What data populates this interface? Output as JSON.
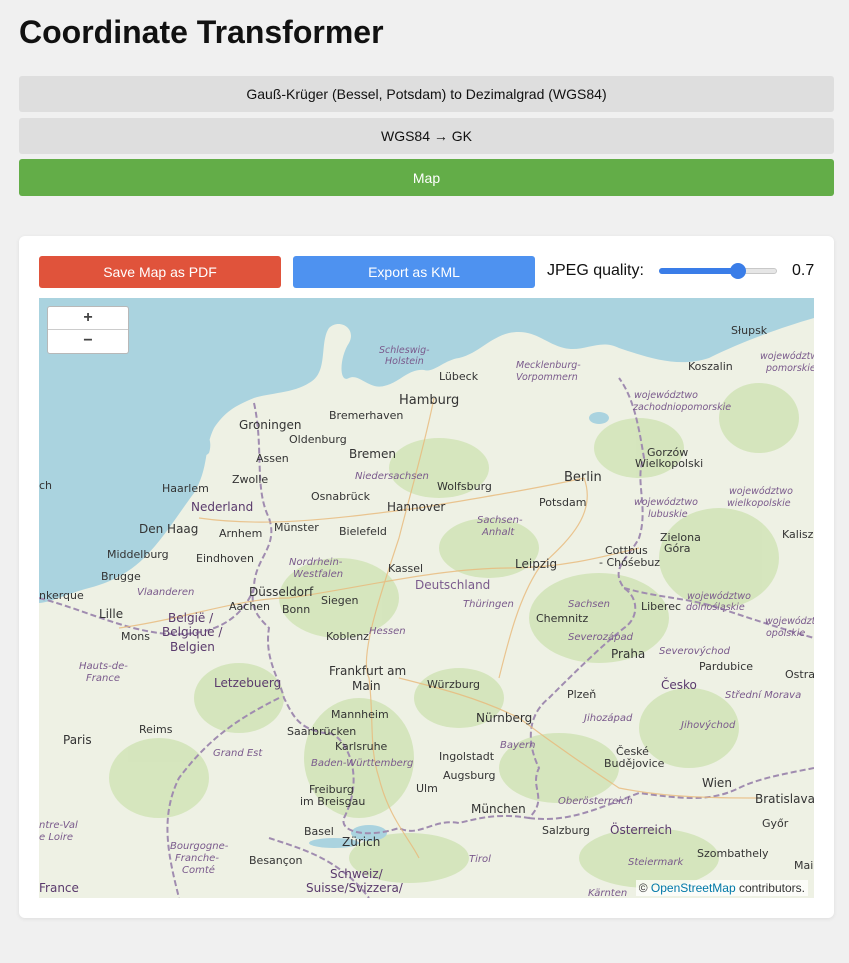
{
  "page": {
    "title": "Coordinate Transformer"
  },
  "tabs": [
    {
      "label": "Gauß-Krüger (Bessel, Potsdam) to Dezimalgrad (WGS84)",
      "active": false
    },
    {
      "label": "WGS84 → GK",
      "active": false
    },
    {
      "label": "Map",
      "active": true
    }
  ],
  "toolbar": {
    "save_pdf_label": "Save Map as PDF",
    "export_kml_label": "Export as KML",
    "jpeg_label": "JPEG quality:",
    "jpeg_value": "0.7",
    "jpeg_fraction": 0.7
  },
  "map": {
    "zoom_in": "+",
    "zoom_out": "−",
    "attribution_link": "OpenStreetMap",
    "attribution_rest": "© ",
    "attribution_tail": " contributors.",
    "colors": {
      "water": "#aad3df",
      "land": "#eef1e4",
      "green": "#cfe3b4",
      "border": "#a08cb0"
    },
    "places": {
      "p1": "Schleswig-",
      "p1b": "Holstein",
      "p2": "Mecklenburg-",
      "p2b": "Vorpommern",
      "c1": "Słupsk",
      "c2": "Koszalin",
      "c3": "Lübeck",
      "c4": "Hamburg",
      "c5": "Bremerhaven",
      "c6": "Groningen",
      "c7": "Oldenburg",
      "c8": "Bremen",
      "c9": "Assen",
      "c10": "Zwolle",
      "c11": "Haarlem",
      "c12": "Nederland",
      "c13": "Den Haag",
      "c14": "Arnhem",
      "c15": "Münster",
      "c16": "Osnabrück",
      "c17": "Bielefeld",
      "c18": "Hannover",
      "c19": "Wolfsburg",
      "c20": "Berlin",
      "c21": "Potsdam",
      "c22": "Gorzów",
      "c22b": "Wielkopolski",
      "c23": "Zielona",
      "c23b": "Góra",
      "c24": "Kalisz",
      "c25": "Middelburg",
      "c26": "Eindhoven",
      "c27": "Brugge",
      "c28": "Düsseldorf",
      "c29": "Kassel",
      "c30": "Deutschland",
      "c31": "Leipzig",
      "c32": "Cottbus",
      "c32b": "- Chóśebuz",
      "c33": "Lille",
      "c34": "Aachen",
      "c35": "Bonn",
      "c36": "Siegen",
      "c37": "Chemnitz",
      "c38": "Liberec",
      "c39": "Mons",
      "c40": "België /",
      "c40b": "Belgique /",
      "c40c": "Belgien",
      "c41": "Koblenz",
      "c42": "Hessen",
      "c43": "Frankfurt am",
      "c43b": "Main",
      "c44": "Praha",
      "c45": "Pardubice",
      "c46": "Letzebuerg",
      "c47": "Würzburg",
      "c48": "Plzeň",
      "c49": "Česko",
      "c50": "Mannheim",
      "c51": "Nürnberg",
      "c52": "Saarbrücken",
      "c53": "Reims",
      "c54": "Paris",
      "c55": "Karlsruhe",
      "c56": "Grand Est",
      "c57": "Bayern",
      "c58": "Ingolstadt",
      "c59": "České",
      "c59b": "Budějovice",
      "c60": "Baden-Württemberg",
      "c61": "Augsburg",
      "c62": "Freiburg",
      "c62b": "im Breisgau",
      "c63": "Ulm",
      "c64": "Wien",
      "c65": "Bratislava",
      "c66": "München",
      "c67": "Oberösterreich",
      "c68": "Basel",
      "c69": "Zürich",
      "c70": "Salzburg",
      "c71": "Österreich",
      "c72": "Győr",
      "c73": "Besançon",
      "c74": "Schweiz/",
      "c74b": "Suisse/Svizzera/",
      "c75": "Tirol",
      "c76": "Steiermark",
      "c77": "Szombathely",
      "c78": "France",
      "c79": "Niedersachsen",
      "c80": "Sachsen-",
      "c80b": "Anhalt",
      "c81": "Nordrhein-",
      "c81b": "Westfalen",
      "c82": "Thüringen",
      "c83": "Sachsen",
      "c84": "Vlaanderen",
      "c85": "Hauts-de-",
      "c85b": "France",
      "c86": "Severozápad",
      "c87": "Severovýchod",
      "c88": "Střední Morava",
      "c89": "Jihozápad",
      "c90": "Jihovýchod",
      "c91": "Bourgogne-",
      "c91b": "Franche-",
      "c91c": "Comté",
      "c92": "Kärnten",
      "c93": "Ostrava",
      "c94": "województwo",
      "c94b": "zachodniopomorskie",
      "c95": "województwo",
      "c95b": "lubuskie",
      "c96": "województwo",
      "c96b": "dolnośląskie",
      "c97": "województwo",
      "c97b": "wielkopolskie",
      "c98": "województwo",
      "c98b": "opolskie",
      "c99": "województwo",
      "c99b": "pomorskie",
      "c100": "ch",
      "c101": "nkerque",
      "c102": "ntre-Val",
      "c102b": "e Loire",
      "c103": "Mai"
    }
  }
}
